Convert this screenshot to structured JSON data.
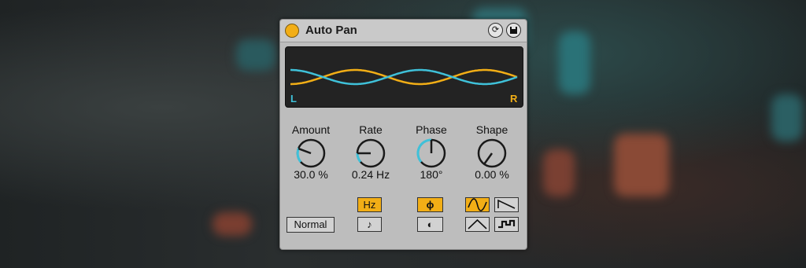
{
  "device": {
    "title": "Auto Pan",
    "power_on": true
  },
  "display": {
    "left_label": "L",
    "right_label": "R",
    "left_color": "#3fc1d9",
    "right_color": "#f2ae16"
  },
  "knobs": [
    {
      "label": "Amount",
      "value": "30.0 %"
    },
    {
      "label": "Rate",
      "value": "0.24 Hz"
    },
    {
      "label": "Phase",
      "value": "180°"
    },
    {
      "label": "Shape",
      "value": "0.00 %"
    }
  ],
  "buttons": {
    "mode": "Normal",
    "hz": "Hz",
    "note": "♪",
    "phase": "ϕ",
    "offset": "◐"
  },
  "colors": {
    "accent": "#f2ae16",
    "cyan": "#3fc1d9",
    "panel": "#bdbdbd"
  }
}
